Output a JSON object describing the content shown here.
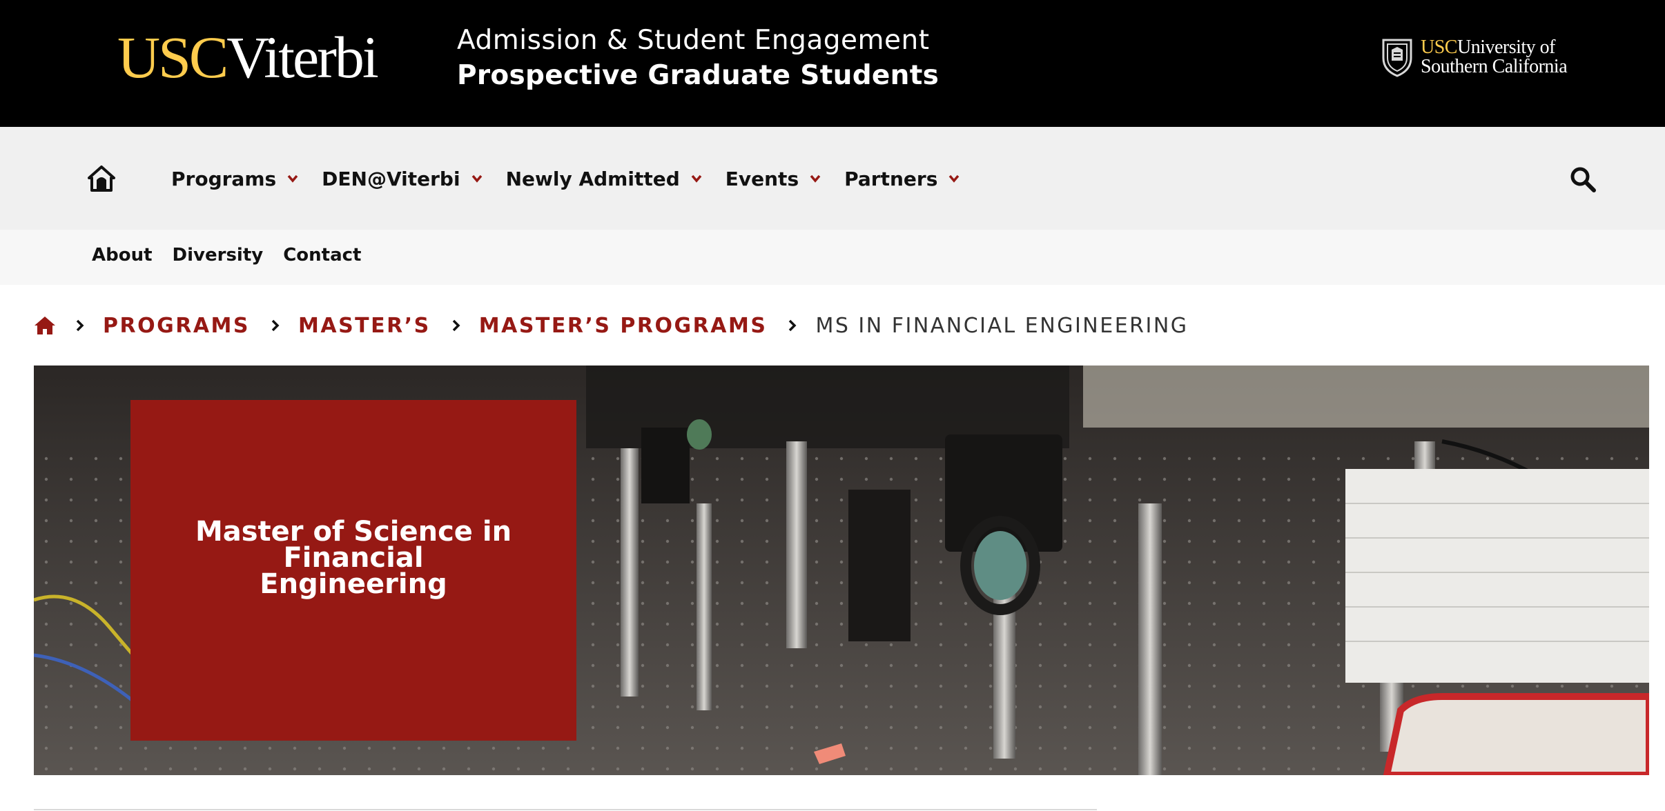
{
  "header": {
    "logo_usc": "USC",
    "logo_viterbi": "Viterbi",
    "site_title": "Admission & Student Engagement",
    "site_subtitle": "Prospective Graduate Students",
    "university_usc": "USC",
    "university_line1": "University of",
    "university_line2": "Southern California"
  },
  "nav": {
    "items": [
      {
        "label": "Programs"
      },
      {
        "label": "DEN@Viterbi"
      },
      {
        "label": "Newly Admitted"
      },
      {
        "label": "Events"
      },
      {
        "label": "Partners"
      }
    ]
  },
  "subnav": {
    "items": [
      {
        "label": "About"
      },
      {
        "label": "Diversity"
      },
      {
        "label": "Contact"
      }
    ]
  },
  "breadcrumb": {
    "links": [
      {
        "label": "PROGRAMS"
      },
      {
        "label": "MASTER’S"
      },
      {
        "label": "MASTER’S PROGRAMS"
      }
    ],
    "current": "MS IN FINANCIAL ENGINEERING"
  },
  "hero": {
    "title": "Master of Science in Financial Engineering"
  },
  "colors": {
    "cardinal": "#961914",
    "gold": "#ffcc4d",
    "header_bg": "#000000",
    "nav_bg": "#f0f0f0",
    "subnav_bg": "#f7f7f7"
  }
}
